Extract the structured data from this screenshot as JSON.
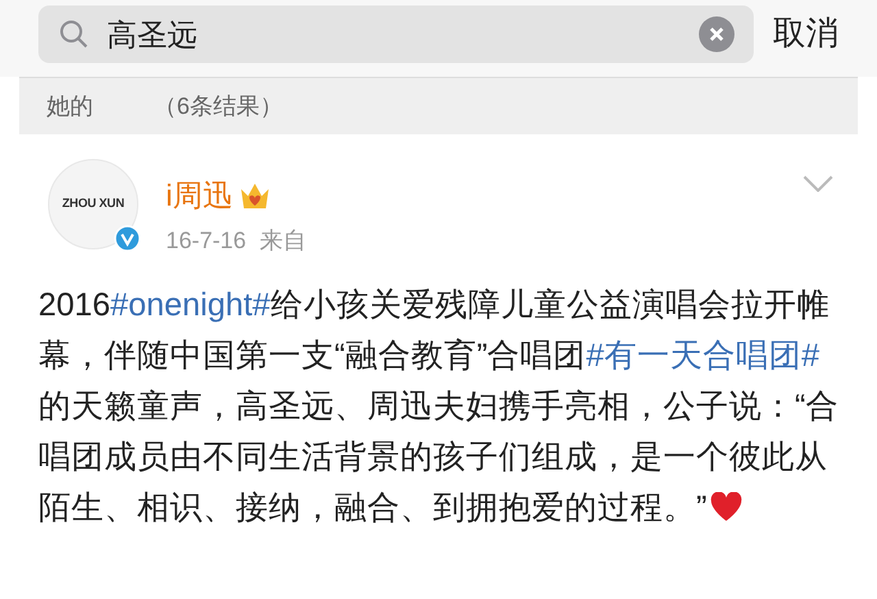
{
  "search": {
    "value": "高圣远",
    "cancel": "取消"
  },
  "results_header": {
    "prefix": "她的",
    "count": "（6条结果）"
  },
  "post": {
    "avatar_text": "ZHOU XUN",
    "author": "i周迅",
    "date": "16-7-16",
    "source": "来自",
    "segments": [
      {
        "kind": "plain",
        "text": "2016"
      },
      {
        "kind": "hashtag",
        "text": "#onenight#"
      },
      {
        "kind": "plain",
        "text": "给小孩关爱残障儿童公益演唱会拉开帷幕，伴随中国第一支“融合教育”合唱团"
      },
      {
        "kind": "hashtag",
        "text": "#有一天合唱团#"
      },
      {
        "kind": "plain",
        "text": "的天籁童声，高圣远、周迅夫妇携手亮相，公子说：“合唱团成员由不同生活背景的孩子们组成，是一个彼此从陌生、相识、接纳，融合、到拥抱爱的过程。”"
      }
    ]
  }
}
